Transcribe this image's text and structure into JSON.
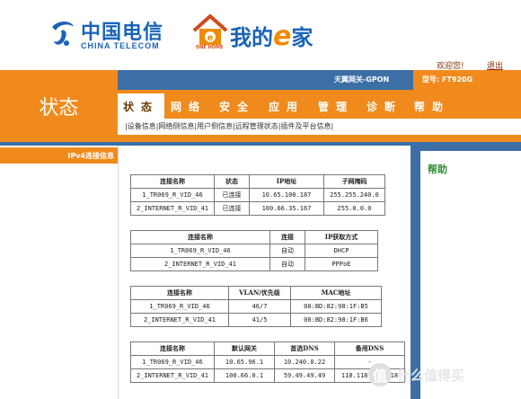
{
  "brand": {
    "telecom_cn": "中国电信",
    "telecom_en": "CHINA TELECOM",
    "ehome_caption": "ONE HOME",
    "ehome_prefix": "我的",
    "ehome_e": "e",
    "ehome_suffix": "家"
  },
  "header": {
    "welcome": "欢迎您!",
    "logout": "退出",
    "gateway_name": "天翼网关-GPON",
    "model_label": "型号: FT920G"
  },
  "page_title": "状态",
  "tabs": [
    {
      "label": "状态",
      "active": true
    },
    {
      "label": "网络",
      "active": false
    },
    {
      "label": "安全",
      "active": false
    },
    {
      "label": "应用",
      "active": false
    },
    {
      "label": "管理",
      "active": false
    },
    {
      "label": "诊断",
      "active": false
    },
    {
      "label": "帮助",
      "active": false
    }
  ],
  "subnav": [
    "设备信息",
    "网络侧信息",
    "用户侧信息",
    "远程管理状态",
    "插件及平台信息"
  ],
  "sidebar": {
    "active_item": "IPv4连接信息"
  },
  "help": {
    "title": "帮助"
  },
  "table1": {
    "headers": [
      "连接名称",
      "状态",
      "IP地址",
      "子网掩码"
    ],
    "rows": [
      [
        "1_TR069_R_VID_46",
        "已连接",
        "10.65.100.187",
        "255.255.240.0"
      ],
      [
        "2_INTERNET_R_VID_41",
        "已连接",
        "100.66.35.167",
        "255.0.0.0"
      ]
    ]
  },
  "table2": {
    "headers": [
      "连接名称",
      "连接",
      "IP获取方式"
    ],
    "rows": [
      [
        "1_TR069_R_VID_46",
        "自动",
        "DHCP"
      ],
      [
        "2_INTERNET_R_VID_41",
        "自动",
        "PPPoE"
      ]
    ]
  },
  "table3": {
    "headers": [
      "连接名称",
      "VLAN/优先级",
      "MAC地址"
    ],
    "rows": [
      [
        "1_TR069_R_VID_46",
        "46/7",
        "00:BD:82:98:1F:B5"
      ],
      [
        "2_INTERNET_R_VID_41",
        "41/5",
        "00:BD:82:98:1F:B6"
      ]
    ]
  },
  "table4": {
    "headers": [
      "连接名称",
      "默认网关",
      "首选DNS",
      "备用DNS"
    ],
    "rows": [
      [
        "1_TR069_R_VID_46",
        "10.65.96.1",
        "10.240.0.22",
        "-"
      ],
      [
        "2_INTERNET_R_VID_41",
        "100.66.0.1",
        "59.49.49.49",
        "118.118.118.118"
      ]
    ]
  },
  "watermark": {
    "icon_char": "值",
    "text": "什么值得买"
  },
  "colors": {
    "orange": "#f18a1d",
    "blue": "#3b6fa6",
    "brand_blue": "#1a64b8"
  }
}
